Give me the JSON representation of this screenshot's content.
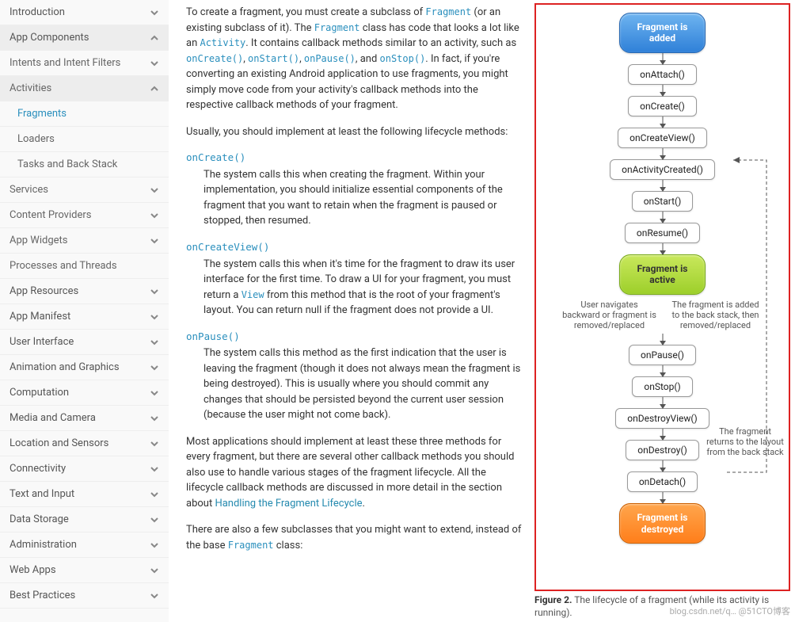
{
  "sidebar": {
    "items": [
      {
        "label": "Introduction",
        "state": "collapsed",
        "level": 0
      },
      {
        "label": "App Components",
        "state": "expanded",
        "level": 0
      },
      {
        "label": "Intents and Intent Filters",
        "state": "collapsed",
        "level": 1
      },
      {
        "label": "Activities",
        "state": "expanded",
        "level": 1
      },
      {
        "label": "Fragments",
        "state": "active",
        "level": 2
      },
      {
        "label": "Loaders",
        "state": "none",
        "level": 2
      },
      {
        "label": "Tasks and Back Stack",
        "state": "none",
        "level": 2
      },
      {
        "label": "Services",
        "state": "collapsed",
        "level": 1
      },
      {
        "label": "Content Providers",
        "state": "collapsed",
        "level": 1
      },
      {
        "label": "App Widgets",
        "state": "collapsed",
        "level": 1
      },
      {
        "label": "Processes and Threads",
        "state": "none",
        "level": 1
      },
      {
        "label": "App Resources",
        "state": "collapsed",
        "level": 0
      },
      {
        "label": "App Manifest",
        "state": "collapsed",
        "level": 0
      },
      {
        "label": "User Interface",
        "state": "collapsed",
        "level": 0
      },
      {
        "label": "Animation and Graphics",
        "state": "collapsed",
        "level": 0
      },
      {
        "label": "Computation",
        "state": "collapsed",
        "level": 0
      },
      {
        "label": "Media and Camera",
        "state": "collapsed",
        "level": 0
      },
      {
        "label": "Location and Sensors",
        "state": "collapsed",
        "level": 0
      },
      {
        "label": "Connectivity",
        "state": "collapsed",
        "level": 0
      },
      {
        "label": "Text and Input",
        "state": "collapsed",
        "level": 0
      },
      {
        "label": "Data Storage",
        "state": "collapsed",
        "level": 0
      },
      {
        "label": "Administration",
        "state": "collapsed",
        "level": 0
      },
      {
        "label": "Web Apps",
        "state": "collapsed",
        "level": 0
      },
      {
        "label": "Best Practices",
        "state": "collapsed",
        "level": 0
      }
    ]
  },
  "content": {
    "p1_a": "To create a fragment, you must create a subclass of ",
    "p1_code_fragment": "Fragment",
    "p1_b": " (or an existing subclass of it). The ",
    "p1_c": " class has code that looks a lot like an ",
    "p1_code_activity": "Activity",
    "p1_d": ". It contains callback methods similar to an activity, such as ",
    "codes": [
      "onCreate()",
      "onStart()",
      "onPause()",
      "onStop()"
    ],
    "p1_commas": [
      ", ",
      ", ",
      ", and ",
      "."
    ],
    "p1_e": " In fact, if you're converting an existing Android application to use fragments, you might simply move code from your activity's callback methods into the respective callback methods of your fragment.",
    "p2": "Usually, you should implement at least the following lifecycle methods:",
    "m1_head": "onCreate()",
    "m1_body": "The system calls this when creating the fragment. Within your implementation, you should initialize essential components of the fragment that you want to retain when the fragment is paused or stopped, then resumed.",
    "m2_head": "onCreateView()",
    "m2_body_a": "The system calls this when it's time for the fragment to draw its user interface for the first time. To draw a UI for your fragment, you must return a ",
    "m2_code_view": "View",
    "m2_body_b": " from this method that is the root of your fragment's layout. You can return null if the fragment does not provide a UI.",
    "m3_head": "onPause()",
    "m3_body": "The system calls this method as the first indication that the user is leaving the fragment (though it does not always mean the fragment is being destroyed). This is usually where you should commit any changes that should be persisted beyond the current user session (because the user might not come back).",
    "p3_a": "Most applications should implement at least these three methods for every fragment, but there are several other callback methods you should also use to handle various stages of the fragment lifecycle. All the lifecycle callback methods are discussed in more detail in the section about ",
    "p3_link": "Handling the Fragment Lifecycle",
    "p3_b": ".",
    "p4_a": "There are also a few subclasses that you might want to extend, instead of the base ",
    "p4_code": "Fragment",
    "p4_b": " class:"
  },
  "diagram": {
    "state_added": "Fragment is\nadded",
    "nodes": [
      "onAttach()",
      "onCreate()",
      "onCreateView()",
      "onActivityCreated()",
      "onStart()",
      "onResume()"
    ],
    "state_active": "Fragment is\nactive",
    "label_left": "User navigates backward or fragment is removed/replaced",
    "label_right": "The fragment is added to the back stack, then removed/replaced",
    "nodes2": [
      "onPause()",
      "onStop()",
      "onDestroyView()"
    ],
    "nodes3": [
      "onDestroy()",
      "onDetach()"
    ],
    "state_destroyed": "Fragment is\ndestroyed",
    "side_note": "The fragment returns to the layout from the back stack"
  },
  "caption": {
    "bold": "Figure 2.",
    "text": " The lifecycle of a fragment (while its activity is running)."
  },
  "watermark": "blog.csdn.net/q…  @51CTO博客"
}
